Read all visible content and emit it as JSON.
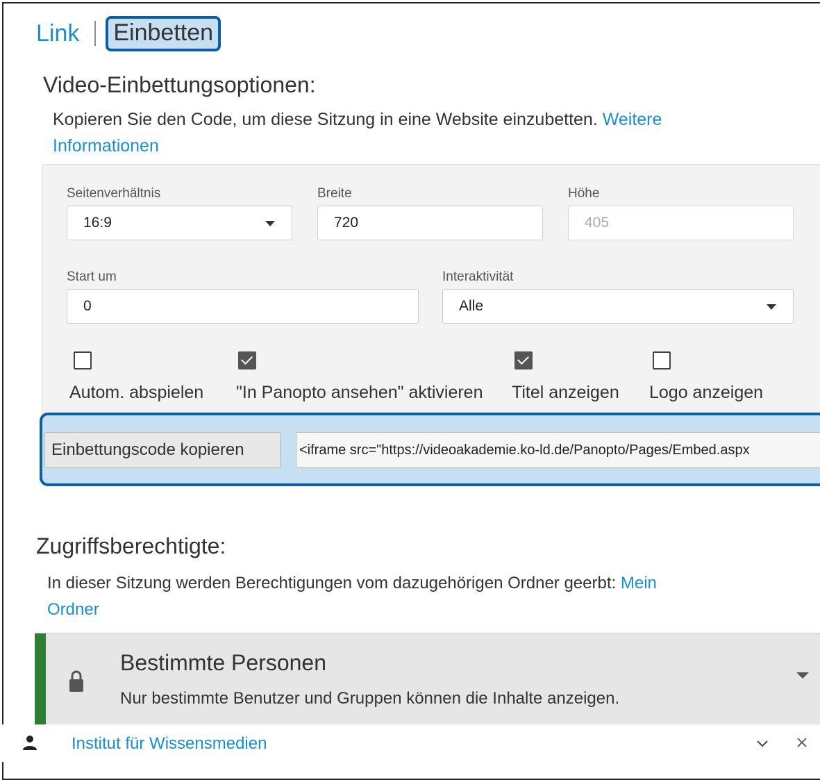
{
  "tabs": {
    "link": "Link",
    "embed": "Einbetten"
  },
  "embed": {
    "heading": "Video-Einbettungsoptionen:",
    "description": "Kopieren Sie den Code, um diese Sitzung in eine Website einzubetten.",
    "more_info_line1": "Weitere",
    "more_info_line2": "Informationen",
    "aspect_label": "Seitenverhältnis",
    "aspect_value": "16:9",
    "width_label": "Breite",
    "width_value": "720",
    "height_label": "Höhe",
    "height_value": "405",
    "start_label": "Start um",
    "start_value": "0",
    "interactivity_label": "Interaktivität",
    "interactivity_value": "Alle",
    "checkboxes": [
      {
        "label": "Autom. abspielen",
        "checked": false
      },
      {
        "label": "\"In Panopto ansehen\" aktivieren",
        "checked": true
      },
      {
        "label": "Titel anzeigen",
        "checked": true
      },
      {
        "label": "Logo anzeigen",
        "checked": false
      }
    ],
    "copy_button": "Einbettungscode kopieren",
    "code": "<iframe src=\"https://videoakademie.ko-ld.de/Panopto/Pages/Embed.aspx"
  },
  "access": {
    "heading": "Zugriffsberechtigte:",
    "description": "In dieser Sitzung werden Berechtigungen vom dazugehörigen Ordner geerbt:",
    "folder_link_line1": "Mein",
    "folder_link_line2": "Ordner",
    "level_title": "Bestimmte Personen",
    "level_description": "Nur bestimmte Benutzer und Gruppen können die Inhalte anzeigen.",
    "user": "Institut für Wissensmedien"
  },
  "colors": {
    "link": "#1a8fc9",
    "highlight": "#c6dff2",
    "highlight_border": "#0b5ea8",
    "access_bar": "#2e7d32"
  }
}
